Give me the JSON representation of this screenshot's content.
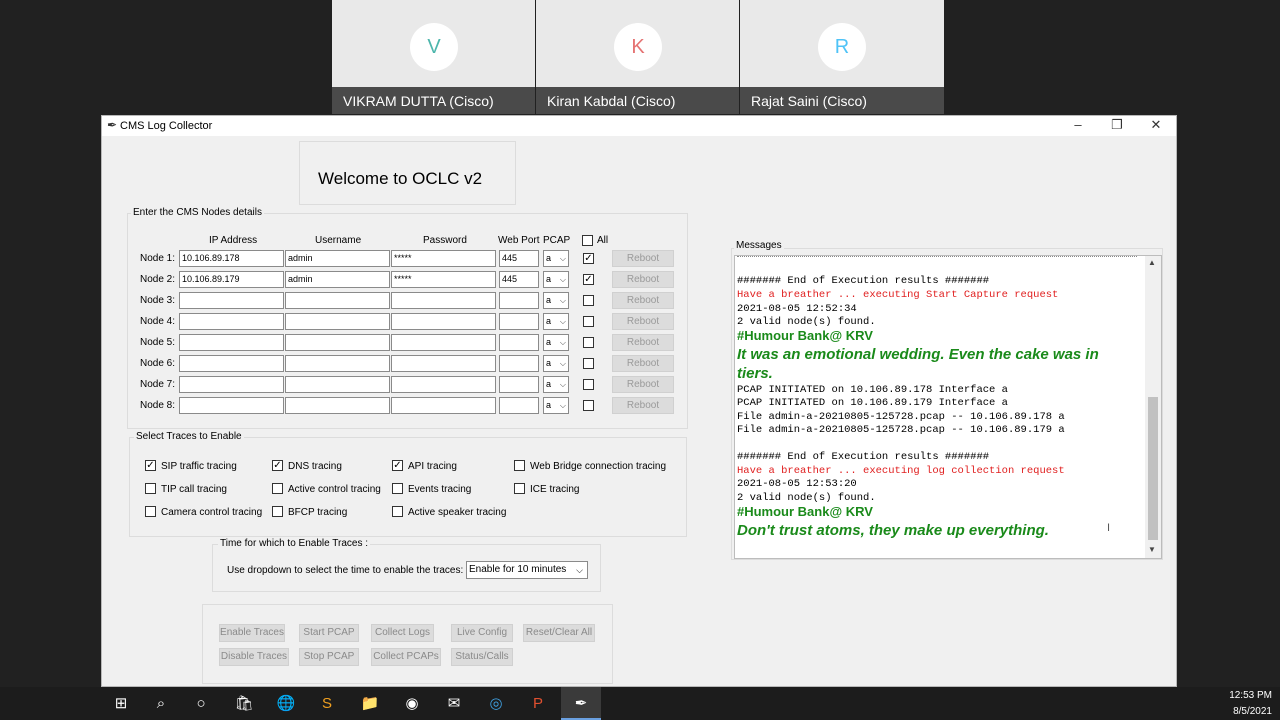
{
  "participants": [
    {
      "initial": "V",
      "name": "VIKRAM DUTTA (Cisco)",
      "color": "#4db6ac"
    },
    {
      "initial": "K",
      "name": "Kiran Kabdal (Cisco)",
      "color": "#e57373"
    },
    {
      "initial": "R",
      "name": "Rajat Saini (Cisco)",
      "color": "#4fc3f7"
    }
  ],
  "window": {
    "title": "CMS Log Collector",
    "welcome": "Welcome to OCLC v2"
  },
  "nodes_section": {
    "legend": "Enter the CMS Nodes details",
    "headers": {
      "ip": "IP Address",
      "user": "Username",
      "pass": "Password",
      "port": "Web Port",
      "pcap": "PCAP",
      "all": "All"
    },
    "reboot_label": "Reboot",
    "rows": [
      {
        "label": "Node 1:",
        "ip": "10.106.89.178",
        "user": "admin",
        "pass": "*****",
        "port": "445",
        "pcap": "a",
        "checked": true
      },
      {
        "label": "Node 2:",
        "ip": "10.106.89.179",
        "user": "admin",
        "pass": "*****",
        "port": "445",
        "pcap": "a",
        "checked": true
      },
      {
        "label": "Node 3:",
        "ip": "",
        "user": "",
        "pass": "",
        "port": "",
        "pcap": "a",
        "checked": false
      },
      {
        "label": "Node 4:",
        "ip": "",
        "user": "",
        "pass": "",
        "port": "",
        "pcap": "a",
        "checked": false
      },
      {
        "label": "Node 5:",
        "ip": "",
        "user": "",
        "pass": "",
        "port": "",
        "pcap": "a",
        "checked": false
      },
      {
        "label": "Node 6:",
        "ip": "",
        "user": "",
        "pass": "",
        "port": "",
        "pcap": "a",
        "checked": false
      },
      {
        "label": "Node 7:",
        "ip": "",
        "user": "",
        "pass": "",
        "port": "",
        "pcap": "a",
        "checked": false
      },
      {
        "label": "Node 8:",
        "ip": "",
        "user": "",
        "pass": "",
        "port": "",
        "pcap": "a",
        "checked": false
      }
    ]
  },
  "traces_section": {
    "legend": "Select Traces to Enable",
    "items": [
      {
        "label": "SIP traffic tracing",
        "checked": true
      },
      {
        "label": "DNS tracing",
        "checked": true
      },
      {
        "label": "API tracing",
        "checked": true
      },
      {
        "label": "Web Bridge connection tracing",
        "checked": false
      },
      {
        "label": "TIP call tracing",
        "checked": false
      },
      {
        "label": "Active control tracing",
        "checked": false
      },
      {
        "label": "Events tracing",
        "checked": false
      },
      {
        "label": "ICE tracing",
        "checked": false
      },
      {
        "label": "Camera control tracing",
        "checked": false
      },
      {
        "label": "BFCP tracing",
        "checked": false
      },
      {
        "label": "Active speaker tracing",
        "checked": false
      }
    ]
  },
  "time_section": {
    "legend": "Time for which to Enable Traces :",
    "prompt": "Use dropdown to select the time to enable the traces:",
    "selected": "Enable for 10 minutes"
  },
  "actions": {
    "enable_traces": "Enable Traces",
    "start_pcap": "Start PCAP",
    "collect_logs": "Collect Logs",
    "live_config": "Live Config",
    "reset_clear": "Reset/Clear All",
    "disable_traces": "Disable Traces",
    "stop_pcap": "Stop PCAP",
    "collect_pcaps": "Collect PCAPs",
    "status_calls": "Status/Calls"
  },
  "messages": {
    "legend": "Messages",
    "lines": [
      {
        "t": "####### End of Execution results #######",
        "s": "black"
      },
      {
        "t": "Have a breather ... executing Start Capture request",
        "s": "red"
      },
      {
        "t": "2021-08-05 12:52:34",
        "s": "black"
      },
      {
        "t": "2 valid node(s) found.",
        "s": "black"
      },
      {
        "t": "#Humour Bank@ KRV",
        "s": "big"
      },
      {
        "t": "It was an emotional wedding. Even the cake was in tiers.",
        "s": "huge"
      },
      {
        "t": "PCAP INITIATED on 10.106.89.178 Interface a",
        "s": "black"
      },
      {
        "t": "PCAP INITIATED on 10.106.89.179 Interface a",
        "s": "black"
      },
      {
        "t": "File admin-a-20210805-125728.pcap -- 10.106.89.178 a",
        "s": "black"
      },
      {
        "t": "File admin-a-20210805-125728.pcap -- 10.106.89.179 a",
        "s": "black"
      },
      {
        "t": "####### End of Execution results #######",
        "s": "black"
      },
      {
        "t": "Have a breather ... executing log collection request",
        "s": "red"
      },
      {
        "t": "2021-08-05 12:53:20",
        "s": "black"
      },
      {
        "t": "2 valid node(s) found.",
        "s": "black"
      },
      {
        "t": "#Humour Bank@ KRV",
        "s": "big"
      },
      {
        "t": "Don't trust atoms, they make up everything.",
        "s": "huge"
      }
    ]
  },
  "taskbar": {
    "time": "12:53 PM",
    "date": "8/5/2021"
  }
}
